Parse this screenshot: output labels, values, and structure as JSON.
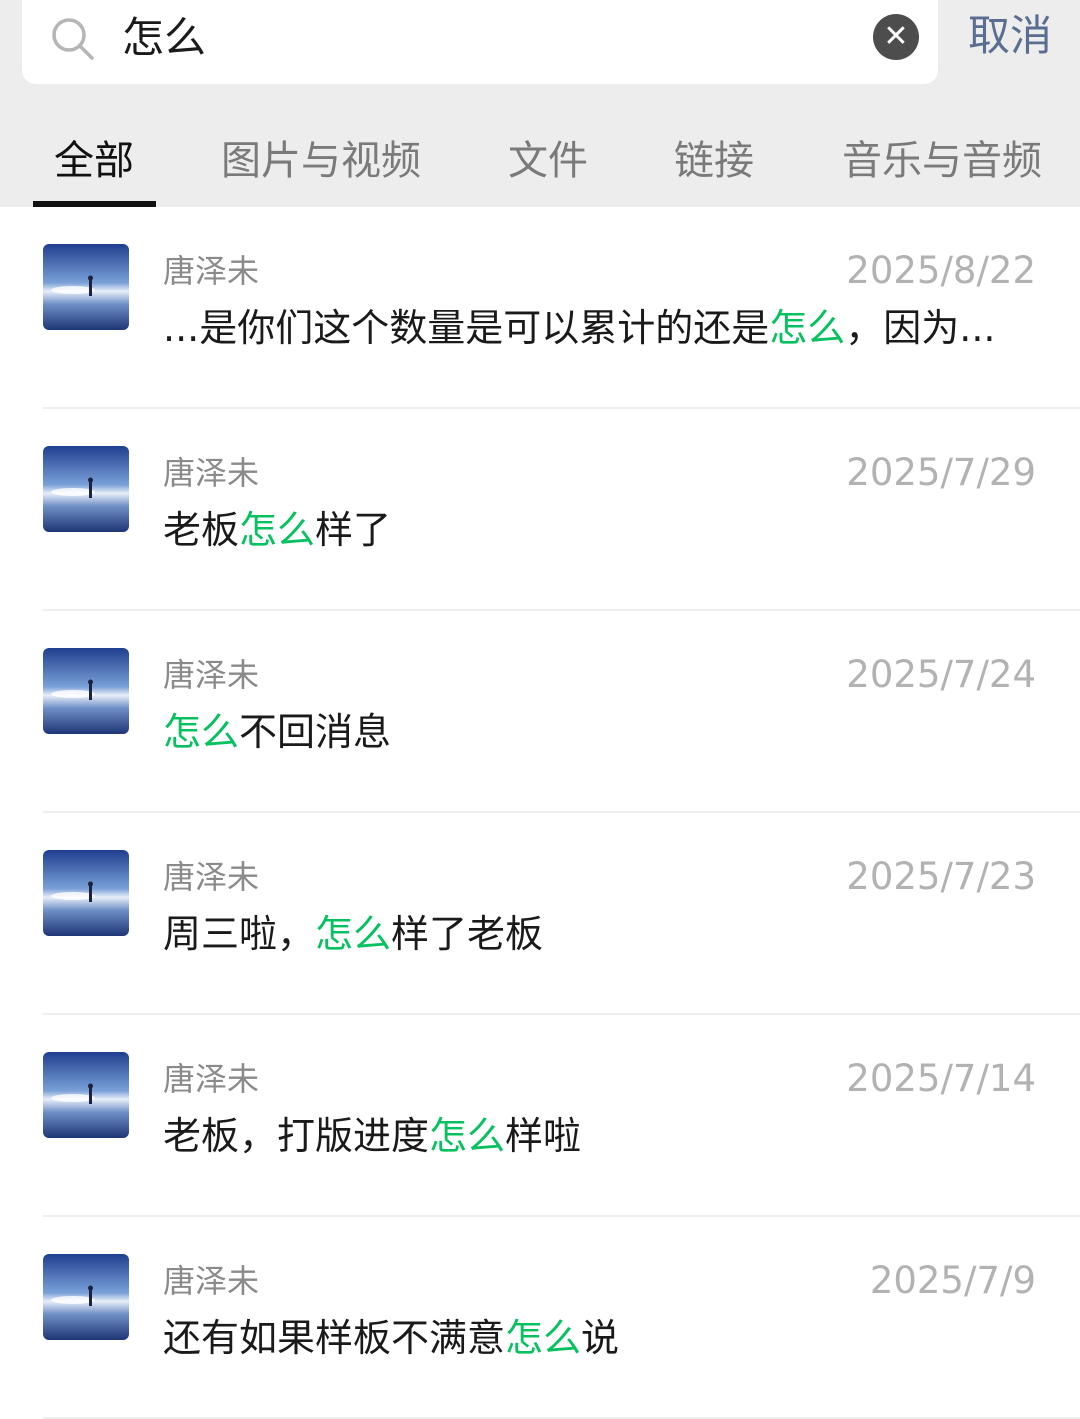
{
  "search": {
    "query": "怎么",
    "clear_icon": "clear-icon",
    "cancel_label": "取消"
  },
  "tabs": [
    {
      "label": "全部",
      "active": true
    },
    {
      "label": "图片与视频",
      "active": false
    },
    {
      "label": "文件",
      "active": false
    },
    {
      "label": "链接",
      "active": false
    },
    {
      "label": "音乐与音频",
      "active": false
    }
  ],
  "colors": {
    "highlight": "#07c160",
    "cancel": "#5a6e91",
    "header_bg": "#ededed"
  },
  "results": [
    {
      "sender": "唐泽未",
      "date": "2025/8/22",
      "message": [
        {
          "text": "...是你们这个数量是可以累计的还是",
          "hl": false
        },
        {
          "text": "怎么",
          "hl": true
        },
        {
          "text": "，因为...",
          "hl": false
        }
      ]
    },
    {
      "sender": "唐泽未",
      "date": "2025/7/29",
      "message": [
        {
          "text": "老板",
          "hl": false
        },
        {
          "text": "怎么",
          "hl": true
        },
        {
          "text": "样了",
          "hl": false
        }
      ]
    },
    {
      "sender": "唐泽未",
      "date": "2025/7/24",
      "message": [
        {
          "text": "怎么",
          "hl": true
        },
        {
          "text": "不回消息",
          "hl": false
        }
      ]
    },
    {
      "sender": "唐泽未",
      "date": "2025/7/23",
      "message": [
        {
          "text": "周三啦，",
          "hl": false
        },
        {
          "text": "怎么",
          "hl": true
        },
        {
          "text": "样了老板",
          "hl": false
        }
      ]
    },
    {
      "sender": "唐泽未",
      "date": "2025/7/14",
      "message": [
        {
          "text": "老板，打版进度",
          "hl": false
        },
        {
          "text": "怎么",
          "hl": true
        },
        {
          "text": "样啦",
          "hl": false
        }
      ]
    },
    {
      "sender": "唐泽未",
      "date": "2025/7/9",
      "message": [
        {
          "text": "还有如果样板不满意",
          "hl": false
        },
        {
          "text": "怎么",
          "hl": true
        },
        {
          "text": "说",
          "hl": false
        }
      ]
    }
  ]
}
